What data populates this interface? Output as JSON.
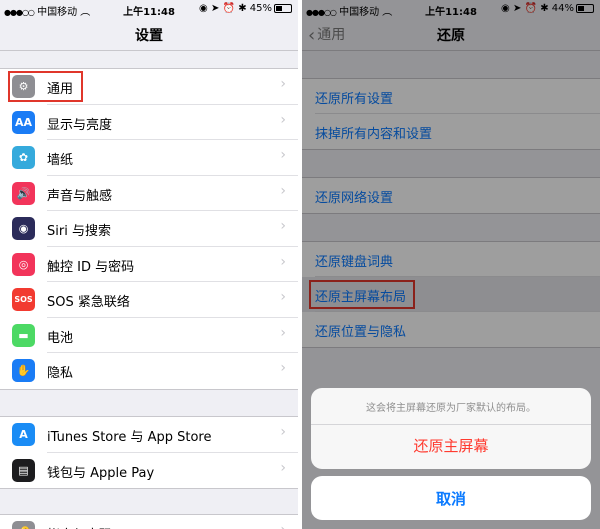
{
  "left": {
    "status": {
      "carrier": "中国移动",
      "time": "上午11:48",
      "battery": "45%",
      "battery_level": 0.45
    },
    "title": "设置",
    "group1": [
      {
        "label": "通用",
        "icon": "gear-icon",
        "color": "#8e8e93",
        "glyph": "⚙"
      },
      {
        "label": "显示与亮度",
        "icon": "display-brightness-icon",
        "color": "#1a7cf5",
        "glyph": "AA"
      },
      {
        "label": "墙纸",
        "icon": "wallpaper-icon",
        "color": "#35aadc",
        "glyph": "✿"
      },
      {
        "label": "声音与触感",
        "icon": "sound-icon",
        "color": "#f2345a",
        "glyph": "🔊"
      },
      {
        "label": "Siri 与搜索",
        "icon": "siri-icon",
        "color": "#2b2b5a",
        "glyph": "◉"
      },
      {
        "label": "触控 ID 与密码",
        "icon": "fingerprint-icon",
        "color": "#f2345a",
        "glyph": "◎"
      },
      {
        "label": "SOS 紧急联络",
        "icon": "sos-icon",
        "color": "#f23a30",
        "glyph": "SOS"
      },
      {
        "label": "电池",
        "icon": "battery-icon",
        "color": "#4cd964",
        "glyph": "▬"
      },
      {
        "label": "隐私",
        "icon": "privacy-hand-icon",
        "color": "#1a7cf5",
        "glyph": "✋"
      }
    ],
    "group2": [
      {
        "label": "iTunes Store 与 App Store",
        "icon": "app-store-icon",
        "color": "#1a8cf5",
        "glyph": "A"
      },
      {
        "label": "钱包与 Apple Pay",
        "icon": "wallet-icon",
        "color": "#1c1c1e",
        "glyph": "▤"
      }
    ],
    "group3": [
      {
        "label": "帐户与密码",
        "icon": "key-icon",
        "color": "#8e8e93",
        "glyph": "🔑"
      }
    ]
  },
  "right": {
    "status": {
      "carrier": "中国移动",
      "time": "上午11:48",
      "battery": "44%",
      "battery_level": 0.44
    },
    "back": "通用",
    "title": "还原",
    "group1": [
      "还原所有设置",
      "抹掉所有内容和设置"
    ],
    "group2": [
      "还原网络设置"
    ],
    "group3": [
      "还原键盘词典",
      "还原主屏幕布局",
      "还原位置与隐私"
    ],
    "sheet": {
      "message": "这会将主屏幕还原为厂家默认的布局。",
      "action": "还原主屏幕",
      "cancel": "取消"
    }
  },
  "colors": {
    "accent": "#0a7aff",
    "destructive": "#ff3b30",
    "highlight_box": "#e0362b"
  }
}
